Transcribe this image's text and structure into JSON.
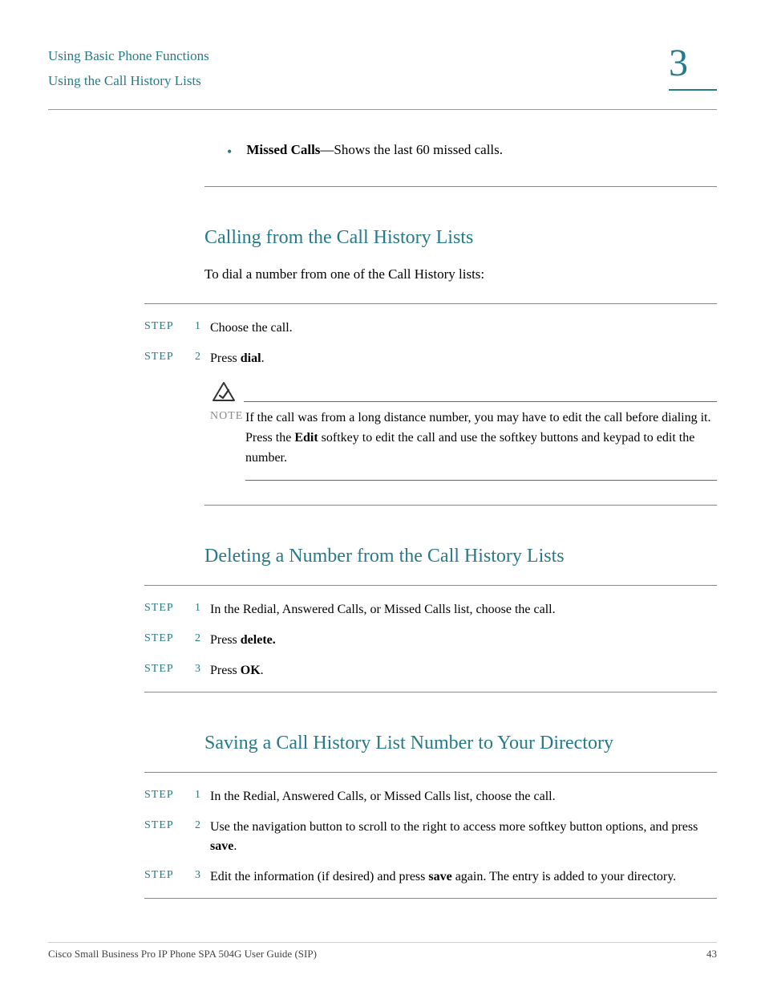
{
  "header": {
    "breadcrumb1": "Using Basic Phone Functions",
    "breadcrumb2": "Using the Call History Lists",
    "chapter": "3"
  },
  "bullet": {
    "bold": "Missed Calls",
    "rest": "—Shows the last 60 missed calls."
  },
  "section1": {
    "title": "Calling from the Call History Lists",
    "intro": "To dial a number from one of the Call History lists:",
    "steps": [
      {
        "label": "STEP",
        "num": "1",
        "pre": "Choose the call."
      },
      {
        "label": "STEP",
        "num": "2",
        "pre": "Press ",
        "bold": "dial",
        "post": "."
      }
    ],
    "note": {
      "label": "NOTE",
      "pre": "If the call was from a long distance number, you may have to edit the call before dialing it. Press the ",
      "bold": "Edit",
      "post": " softkey to edit the call and use the softkey buttons and keypad to edit the number."
    }
  },
  "section2": {
    "title": "Deleting a Number from the Call History Lists",
    "steps": [
      {
        "label": "STEP",
        "num": "1",
        "pre": "In the Redial, Answered Calls, or Missed Calls list, choose the call."
      },
      {
        "label": "STEP",
        "num": "2",
        "pre": "Press ",
        "bold": "delete."
      },
      {
        "label": "STEP",
        "num": "3",
        "pre": "Press ",
        "bold": "OK",
        "post": "."
      }
    ]
  },
  "section3": {
    "title": "Saving a Call History List Number to Your Directory",
    "steps": [
      {
        "label": "STEP",
        "num": "1",
        "pre": "In the Redial, Answered Calls, or Missed Calls list, choose the call."
      },
      {
        "label": "STEP",
        "num": "2",
        "pre": "Use the navigation button to scroll to the right to access more softkey button options, and press ",
        "bold": "save",
        "post": "."
      },
      {
        "label": "STEP",
        "num": "3",
        "pre": "Edit the information (if desired) and press ",
        "bold": "save",
        "post": " again. The entry is added to your directory."
      }
    ]
  },
  "footer": {
    "title": "Cisco Small Business Pro IP Phone SPA 504G User Guide (SIP)",
    "page": "43"
  }
}
